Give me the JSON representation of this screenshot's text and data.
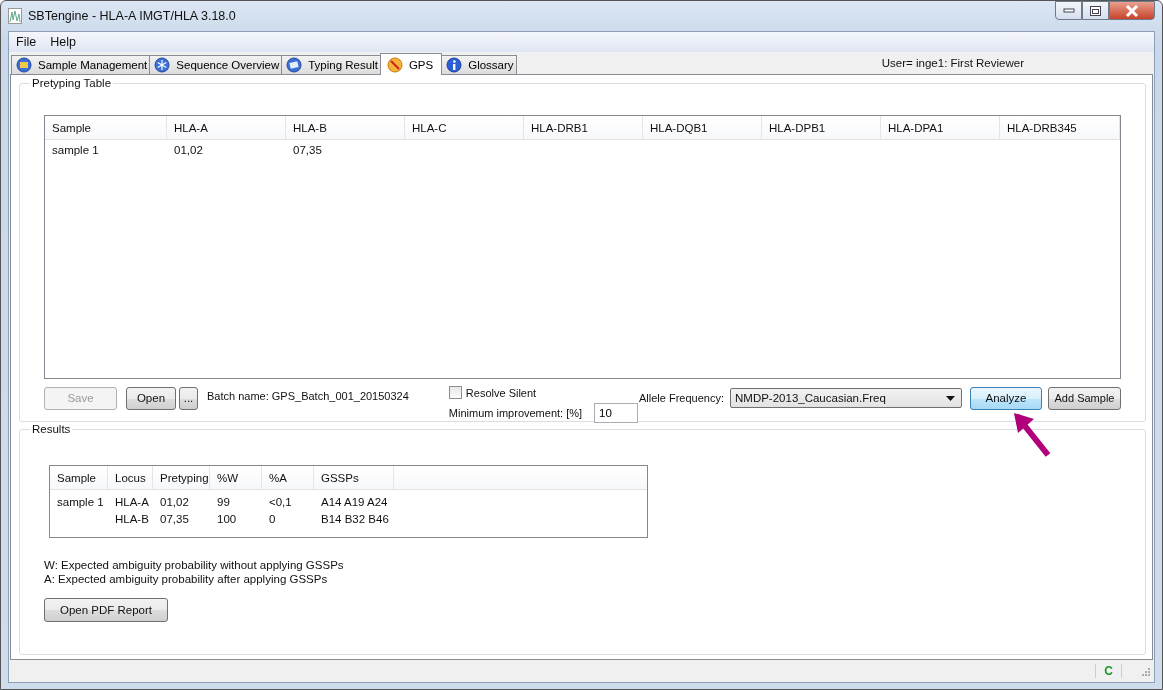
{
  "window": {
    "title": "SBTengine - HLA-A IMGT/HLA 3.18.0"
  },
  "menu": [
    "File",
    "Help"
  ],
  "tabs": [
    {
      "label": "Sample Management",
      "selected": false
    },
    {
      "label": "Sequence Overview",
      "selected": false
    },
    {
      "label": "Typing Result",
      "selected": false
    },
    {
      "label": "GPS",
      "selected": true
    },
    {
      "label": "Glossary",
      "selected": false
    }
  ],
  "user": "User= inge1: First Reviewer",
  "pretyping": {
    "title": "Pretyping Table",
    "columns": [
      "Sample",
      "HLA-A",
      "HLA-B",
      "HLA-C",
      "HLA-DRB1",
      "HLA-DQB1",
      "HLA-DPB1",
      "HLA-DPA1",
      "HLA-DRB345"
    ],
    "rows": [
      [
        "sample 1",
        "01,02",
        "07,35"
      ]
    ],
    "save": {
      "label": "Save",
      "disabled": true
    },
    "open": {
      "label": "Open",
      "disabled": false
    },
    "browse": "...",
    "batch_name": "Batch name: GPS_Batch_001_20150324",
    "resolve_silent": {
      "label": "Resolve Silent",
      "checked": false
    },
    "min_improvement": {
      "label": "Minimum improvement: [%]",
      "value": "10"
    },
    "allele_frequency": {
      "label": "Allele Frequency:",
      "value": "NMDP-2013_Caucasian.Freq"
    },
    "analyze": {
      "label": "Analyze",
      "highlighted": true
    },
    "add_sample": {
      "label": "Add Sample",
      "highlighted": false
    }
  },
  "results": {
    "title": "Results",
    "columns": [
      "Sample",
      "Locus",
      "Pretyping",
      "%W",
      "%A",
      "GSSPs"
    ],
    "samples": [
      {
        "name": "sample 1",
        "loci": [
          [
            "HLA-A",
            "01,02",
            "99",
            "<0,1",
            "A14 A19 A24"
          ],
          [
            "HLA-B",
            "07,35",
            "100",
            "0",
            "B14 B32 B46"
          ]
        ]
      }
    ],
    "notes": [
      "W: Expected ambiguity probability without applying GSSPs",
      "A: Expected ambiguity probability after applying GSSPs"
    ],
    "open_pdf": "Open PDF Report"
  },
  "status_bar": {
    "indicator": "C"
  }
}
